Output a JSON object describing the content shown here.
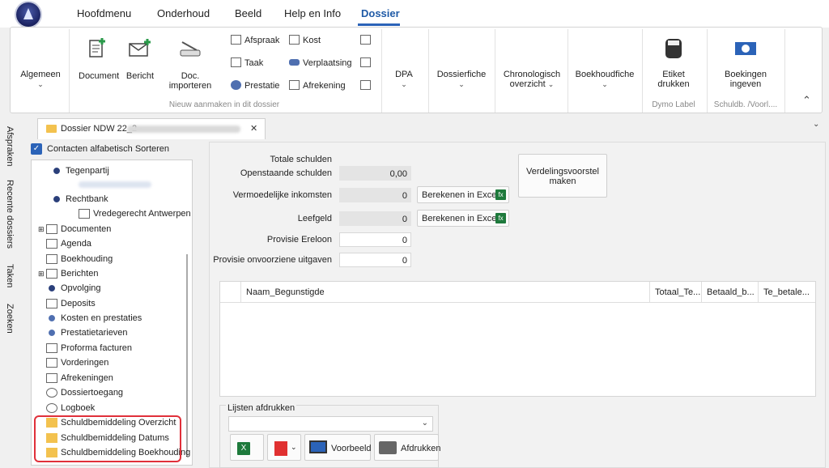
{
  "menubar": {
    "items": [
      "Hoofdmenu",
      "Onderhoud",
      "Beeld",
      "Help en Info",
      "Dossier"
    ],
    "active": "Dossier"
  },
  "ribbon": {
    "algemeen": "Algemeen",
    "nieuw_group_label": "Nieuw aanmaken in dit dossier",
    "document": "Document",
    "bericht": "Bericht",
    "doc_importeren": "Doc. importeren",
    "small": [
      "Afspraak",
      "Taak",
      "Prestatie",
      "Kost",
      "Verplaatsing",
      "Afrekening"
    ],
    "dpa": "DPA",
    "dossierfiche": "Dossierfiche",
    "chronologisch1": "Chronologisch",
    "chronologisch2": "overzicht",
    "boekhoudfiche": "Boekhoudfiche",
    "etiket1": "Etiket",
    "etiket2": "drukken",
    "dymo_label": "Dymo Label",
    "boekingen1": "Boekingen",
    "boekingen2": "ingeven",
    "schuld_label": "Schuldb. /Voorl...."
  },
  "doc_tab": {
    "title": "Dossier NDW 22_2 -",
    "close": "✕"
  },
  "side_tabs": [
    "Afspraken",
    "Recente dossiers",
    "Taken",
    "Zoeken"
  ],
  "sort_checkbox": {
    "label": "Contacten alfabetisch Sorteren",
    "checked": true
  },
  "tree": [
    {
      "label": "Tegenpartij"
    },
    {
      "label": "Rechtbank"
    },
    {
      "label": "Vredegerecht Antwerpen"
    },
    {
      "label": "Documenten"
    },
    {
      "label": "Agenda"
    },
    {
      "label": "Boekhouding"
    },
    {
      "label": "Berichten"
    },
    {
      "label": "Opvolging"
    },
    {
      "label": "Deposits"
    },
    {
      "label": "Kosten en prestaties"
    },
    {
      "label": "Prestatietarieven"
    },
    {
      "label": "Proforma facturen"
    },
    {
      "label": "Vorderingen"
    },
    {
      "label": "Afrekeningen"
    },
    {
      "label": "Dossiertoegang"
    },
    {
      "label": "Logboek"
    },
    {
      "label": "Schuldbemiddeling Overzicht"
    },
    {
      "label": "Schuldbemiddeling Datums"
    },
    {
      "label": "Schuldbemiddeling Boekhouding"
    }
  ],
  "form": {
    "totale_schulden": "Totale schulden",
    "openstaande": "Openstaande schulden",
    "openstaande_val": "0,00",
    "vermoedelijke": "Vermoedelijke inkomsten",
    "vermoedelijke_val": "0",
    "leefgeld": "Leefgeld",
    "leefgeld_val": "0",
    "provisie_ereloon": "Provisie Ereloon",
    "provisie_ereloon_val": "0",
    "provisie_onvoorziene": "Provisie onvoorziene uitgaven",
    "provisie_onvoorziene_val": "0",
    "berekenen": "Berekenen in Excel",
    "verdelings1": "Verdelingsvoorstel",
    "verdelings2": "maken"
  },
  "grid": {
    "columns": [
      "Naam_Begunstigde",
      "Totaal_Te...",
      "Betaald_b...",
      "Te_betale..."
    ]
  },
  "lijsten": {
    "title": "Lijsten afdrukken",
    "voorbeeld": "Voorbeeld",
    "afdrukken": "Afdrukken"
  },
  "colors": {
    "accent": "#2b63b8",
    "highlight": "#e0303a",
    "excel": "#1e7a3c"
  }
}
